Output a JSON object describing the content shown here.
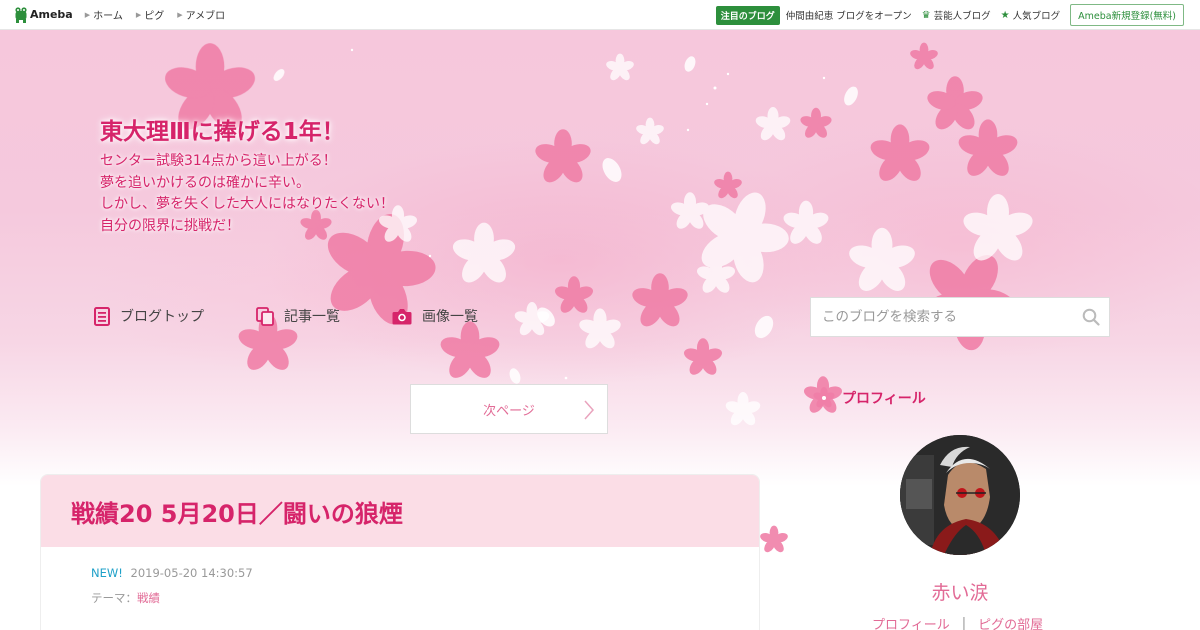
{
  "topbar": {
    "logo_text": "Ameba",
    "nav": [
      "ホーム",
      "ピグ",
      "アメブロ"
    ],
    "focus_badge": "注目のブログ",
    "focus_link": "仲間由紀恵 ブログをオープン",
    "celebrity_link": "芸能人ブログ",
    "popular_link": "人気ブログ",
    "register_button": "Ameba新規登録(無料)"
  },
  "blog": {
    "title": "東大理Ⅲに捧げる1年！",
    "description": [
      "センター試験314点から這い上がる！",
      "夢を追いかけるのは確かに辛い。",
      "しかし、夢を失くした大人にはなりたくない！",
      "自分の限界に挑戦だ！"
    ]
  },
  "blog_nav": {
    "top": "ブログトップ",
    "entries": "記事一覧",
    "images": "画像一覧"
  },
  "search": {
    "placeholder": "このブログを検索する"
  },
  "pager": {
    "next_label": "次ページ"
  },
  "profile": {
    "heading": "プロフィール",
    "name": "赤い涙",
    "profile_link": "プロフィール",
    "separator": "|",
    "pigg_link": "ピグの部屋"
  },
  "article": {
    "title": "戦績20 5月20日／闘いの狼煙",
    "new_label": "NEW!",
    "datetime": "2019-05-20 14:30:57",
    "theme_label": "テーマ：",
    "theme_value": "戦績"
  },
  "colors": {
    "accent": "#d6246a",
    "link_pink": "#e26b96",
    "ameba_green": "#2d8f3c",
    "new_blue": "#1ea0c8",
    "article_head_bg": "#fbdde6"
  },
  "icons": [
    "ameba-frog-icon",
    "document-icon",
    "copy-icon",
    "camera-icon",
    "search-icon",
    "chevron-right-icon",
    "sakura-icon",
    "crown-icon",
    "star-icon"
  ]
}
